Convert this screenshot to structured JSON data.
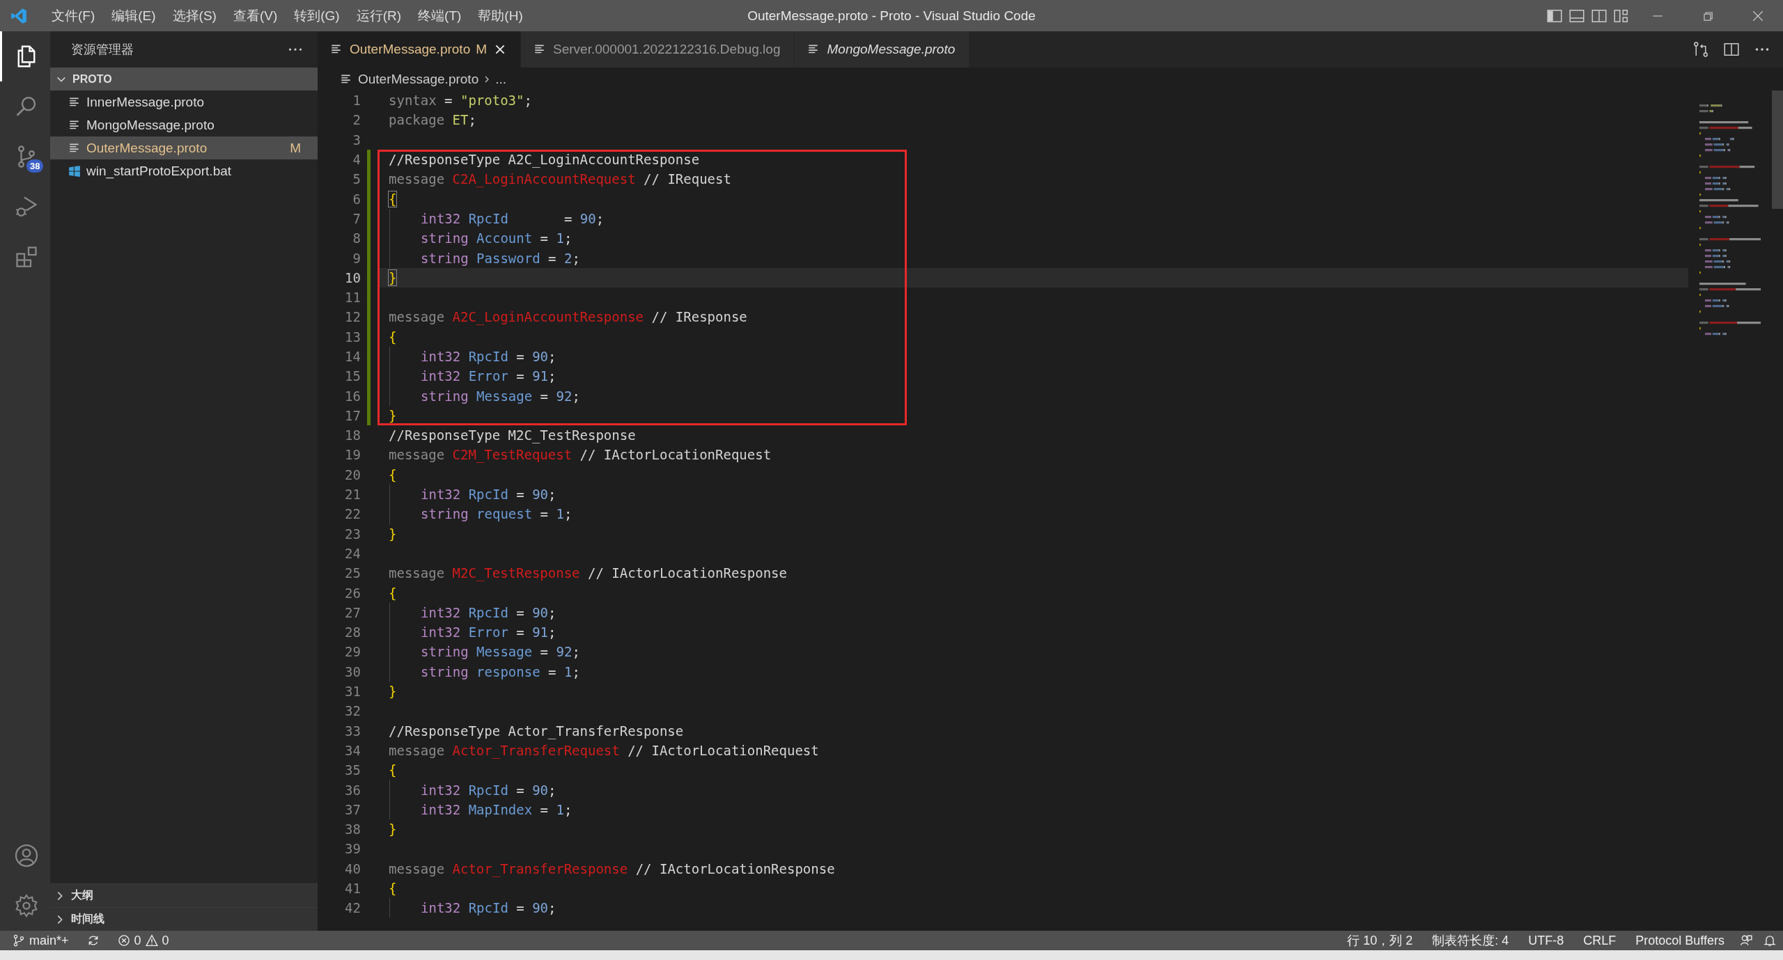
{
  "window": {
    "title": "OuterMessage.proto - Proto - Visual Studio Code"
  },
  "menu": [
    "文件(F)",
    "编辑(E)",
    "选择(S)",
    "查看(V)",
    "转到(G)",
    "运行(R)",
    "终端(T)",
    "帮助(H)"
  ],
  "activity_bar": [
    {
      "kind": "explorer",
      "selected": true
    },
    {
      "kind": "search",
      "selected": false
    },
    {
      "kind": "source-control",
      "selected": false,
      "badge": "38"
    },
    {
      "kind": "run",
      "selected": false
    },
    {
      "kind": "extensions",
      "selected": false
    },
    {
      "kind": "account",
      "selected": false
    },
    {
      "kind": "settings",
      "selected": false
    }
  ],
  "sidebar": {
    "title": "资源管理器",
    "folder": {
      "label": "PROTO",
      "expanded": true
    },
    "files": [
      {
        "name": "InnerMessage.proto",
        "kind": "text",
        "selected": false
      },
      {
        "name": "MongoMessage.proto",
        "kind": "text",
        "selected": false
      },
      {
        "name": "OuterMessage.proto",
        "kind": "text",
        "selected": true,
        "badge": "M"
      },
      {
        "name": "win_startProtoExport.bat",
        "kind": "windows",
        "selected": false
      }
    ],
    "sections": [
      {
        "label": "大纲",
        "expanded": false
      },
      {
        "label": "时间线",
        "expanded": false
      }
    ]
  },
  "tabs": [
    {
      "label": "OuterMessage.proto",
      "selected": true,
      "badge": "M",
      "preview": false
    },
    {
      "label": "Server.000001.2022122316.Debug.log",
      "selected": false,
      "preview": false
    },
    {
      "label": "MongoMessage.proto",
      "selected": false,
      "preview": true
    }
  ],
  "breadcrumb": [
    "OuterMessage.proto",
    "..."
  ],
  "editor": {
    "lines": [
      {
        "number": "1",
        "tokens": [
          {
            "text": "syntax",
            "kind": "keyword"
          },
          {
            "text": " = ",
            "kind": "plain"
          },
          {
            "text": "\"proto3\"",
            "kind": "string"
          },
          {
            "text": ";",
            "kind": "plain"
          }
        ]
      },
      {
        "number": "2",
        "tokens": [
          {
            "text": "package ",
            "kind": "keyword"
          },
          {
            "text": "ET",
            "kind": "string"
          },
          {
            "text": ";",
            "kind": "plain"
          }
        ]
      },
      {
        "number": "3"
      },
      {
        "number": "4",
        "modified": true,
        "boxed": true,
        "tokens": [
          {
            "text": "//ResponseType A2C_LoginAccountResponse",
            "kind": "comment"
          }
        ]
      },
      {
        "number": "5",
        "modified": true,
        "boxed": true,
        "tokens": [
          {
            "text": "message ",
            "kind": "keyword"
          },
          {
            "text": "C2A_LoginAccountRequest",
            "kind": "name"
          },
          {
            "text": " // IRequest",
            "kind": "comment"
          }
        ]
      },
      {
        "number": "6",
        "modified": true,
        "boxed": true,
        "tokens": [
          {
            "text": "{",
            "kind": "bracket-match"
          }
        ]
      },
      {
        "number": "7",
        "modified": true,
        "boxed": true,
        "indented": true,
        "tokens": [
          {
            "text": "int32 ",
            "kind": "type"
          },
          {
            "text": "RpcId",
            "kind": "field"
          },
          {
            "text": "       = ",
            "kind": "plain"
          },
          {
            "text": "90",
            "kind": "number"
          },
          {
            "text": ";",
            "kind": "plain"
          }
        ]
      },
      {
        "number": "8",
        "modified": true,
        "boxed": true,
        "indented": true,
        "tokens": [
          {
            "text": "string ",
            "kind": "type"
          },
          {
            "text": "Account",
            "kind": "field"
          },
          {
            "text": " = ",
            "kind": "plain"
          },
          {
            "text": "1",
            "kind": "number"
          },
          {
            "text": ";",
            "kind": "plain"
          }
        ]
      },
      {
        "number": "9",
        "modified": true,
        "boxed": true,
        "indented": true,
        "tokens": [
          {
            "text": "string ",
            "kind": "type"
          },
          {
            "text": "Password",
            "kind": "field"
          },
          {
            "text": " = ",
            "kind": "plain"
          },
          {
            "text": "2",
            "kind": "number"
          },
          {
            "text": ";",
            "kind": "plain"
          }
        ]
      },
      {
        "number": "10",
        "modified": true,
        "boxed": true,
        "current": true,
        "tokens": [
          {
            "text": "}",
            "kind": "bracket-match"
          }
        ]
      },
      {
        "number": "11",
        "modified": true,
        "boxed": true
      },
      {
        "number": "12",
        "modified": true,
        "boxed": true,
        "tokens": [
          {
            "text": "message ",
            "kind": "keyword"
          },
          {
            "text": "A2C_LoginAccountResponse",
            "kind": "name"
          },
          {
            "text": " // IResponse",
            "kind": "comment"
          }
        ]
      },
      {
        "number": "13",
        "modified": true,
        "boxed": true,
        "tokens": [
          {
            "text": "{",
            "kind": "bracket"
          }
        ]
      },
      {
        "number": "14",
        "modified": true,
        "boxed": true,
        "indented": true,
        "tokens": [
          {
            "text": "int32 ",
            "kind": "type"
          },
          {
            "text": "RpcId",
            "kind": "field"
          },
          {
            "text": " = ",
            "kind": "plain"
          },
          {
            "text": "90",
            "kind": "number"
          },
          {
            "text": ";",
            "kind": "plain"
          }
        ]
      },
      {
        "number": "15",
        "modified": true,
        "boxed": true,
        "indented": true,
        "tokens": [
          {
            "text": "int32 ",
            "kind": "type"
          },
          {
            "text": "Error",
            "kind": "field"
          },
          {
            "text": " = ",
            "kind": "plain"
          },
          {
            "text": "91",
            "kind": "number"
          },
          {
            "text": ";",
            "kind": "plain"
          }
        ]
      },
      {
        "number": "16",
        "modified": true,
        "boxed": true,
        "indented": true,
        "tokens": [
          {
            "text": "string ",
            "kind": "type"
          },
          {
            "text": "Message",
            "kind": "field"
          },
          {
            "text": " = ",
            "kind": "plain"
          },
          {
            "text": "92",
            "kind": "number"
          },
          {
            "text": ";",
            "kind": "plain"
          }
        ]
      },
      {
        "number": "17",
        "modified": true,
        "boxed": true,
        "tokens": [
          {
            "text": "}",
            "kind": "bracket"
          }
        ]
      },
      {
        "number": "18",
        "tokens": [
          {
            "text": "//ResponseType M2C_TestResponse",
            "kind": "comment"
          }
        ]
      },
      {
        "number": "19",
        "tokens": [
          {
            "text": "message ",
            "kind": "keyword"
          },
          {
            "text": "C2M_TestRequest",
            "kind": "name"
          },
          {
            "text": " // IActorLocationRequest",
            "kind": "comment"
          }
        ]
      },
      {
        "number": "20",
        "tokens": [
          {
            "text": "{",
            "kind": "bracket"
          }
        ]
      },
      {
        "number": "21",
        "indented": true,
        "tokens": [
          {
            "text": "int32 ",
            "kind": "type"
          },
          {
            "text": "RpcId",
            "kind": "field"
          },
          {
            "text": " = ",
            "kind": "plain"
          },
          {
            "text": "90",
            "kind": "number"
          },
          {
            "text": ";",
            "kind": "plain"
          }
        ]
      },
      {
        "number": "22",
        "indented": true,
        "tokens": [
          {
            "text": "string ",
            "kind": "type"
          },
          {
            "text": "request",
            "kind": "field"
          },
          {
            "text": " = ",
            "kind": "plain"
          },
          {
            "text": "1",
            "kind": "number"
          },
          {
            "text": ";",
            "kind": "plain"
          }
        ]
      },
      {
        "number": "23",
        "tokens": [
          {
            "text": "}",
            "kind": "bracket"
          }
        ]
      },
      {
        "number": "24"
      },
      {
        "number": "25",
        "tokens": [
          {
            "text": "message ",
            "kind": "keyword"
          },
          {
            "text": "M2C_TestResponse",
            "kind": "name"
          },
          {
            "text": " // IActorLocationResponse",
            "kind": "comment"
          }
        ]
      },
      {
        "number": "26",
        "tokens": [
          {
            "text": "{",
            "kind": "bracket"
          }
        ]
      },
      {
        "number": "27",
        "indented": true,
        "tokens": [
          {
            "text": "int32 ",
            "kind": "type"
          },
          {
            "text": "RpcId",
            "kind": "field"
          },
          {
            "text": " = ",
            "kind": "plain"
          },
          {
            "text": "90",
            "kind": "number"
          },
          {
            "text": ";",
            "kind": "plain"
          }
        ]
      },
      {
        "number": "28",
        "indented": true,
        "tokens": [
          {
            "text": "int32 ",
            "kind": "type"
          },
          {
            "text": "Error",
            "kind": "field"
          },
          {
            "text": " = ",
            "kind": "plain"
          },
          {
            "text": "91",
            "kind": "number"
          },
          {
            "text": ";",
            "kind": "plain"
          }
        ]
      },
      {
        "number": "29",
        "indented": true,
        "tokens": [
          {
            "text": "string ",
            "kind": "type"
          },
          {
            "text": "Message",
            "kind": "field"
          },
          {
            "text": " = ",
            "kind": "plain"
          },
          {
            "text": "92",
            "kind": "number"
          },
          {
            "text": ";",
            "kind": "plain"
          }
        ]
      },
      {
        "number": "30",
        "indented": true,
        "tokens": [
          {
            "text": "string ",
            "kind": "type"
          },
          {
            "text": "response",
            "kind": "field"
          },
          {
            "text": " = ",
            "kind": "plain"
          },
          {
            "text": "1",
            "kind": "number"
          },
          {
            "text": ";",
            "kind": "plain"
          }
        ]
      },
      {
        "number": "31",
        "tokens": [
          {
            "text": "}",
            "kind": "bracket"
          }
        ]
      },
      {
        "number": "32"
      },
      {
        "number": "33",
        "tokens": [
          {
            "text": "//ResponseType Actor_TransferResponse",
            "kind": "comment"
          }
        ]
      },
      {
        "number": "34",
        "tokens": [
          {
            "text": "message ",
            "kind": "keyword"
          },
          {
            "text": "Actor_TransferRequest",
            "kind": "name"
          },
          {
            "text": " // IActorLocationRequest",
            "kind": "comment"
          }
        ]
      },
      {
        "number": "35",
        "tokens": [
          {
            "text": "{",
            "kind": "bracket"
          }
        ]
      },
      {
        "number": "36",
        "indented": true,
        "tokens": [
          {
            "text": "int32 ",
            "kind": "type"
          },
          {
            "text": "RpcId",
            "kind": "field"
          },
          {
            "text": " = ",
            "kind": "plain"
          },
          {
            "text": "90",
            "kind": "number"
          },
          {
            "text": ";",
            "kind": "plain"
          }
        ]
      },
      {
        "number": "37",
        "indented": true,
        "tokens": [
          {
            "text": "int32 ",
            "kind": "type"
          },
          {
            "text": "MapIndex",
            "kind": "field"
          },
          {
            "text": " = ",
            "kind": "plain"
          },
          {
            "text": "1",
            "kind": "number"
          },
          {
            "text": ";",
            "kind": "plain"
          }
        ]
      },
      {
        "number": "38",
        "tokens": [
          {
            "text": "}",
            "kind": "bracket"
          }
        ]
      },
      {
        "number": "39"
      },
      {
        "number": "40",
        "tokens": [
          {
            "text": "message ",
            "kind": "keyword"
          },
          {
            "text": "Actor_TransferResponse",
            "kind": "name"
          },
          {
            "text": " // IActorLocationResponse",
            "kind": "comment"
          }
        ]
      },
      {
        "number": "41",
        "tokens": [
          {
            "text": "{",
            "kind": "bracket"
          }
        ]
      },
      {
        "number": "42",
        "indented": true,
        "tokens": [
          {
            "text": "int32 ",
            "kind": "type"
          },
          {
            "text": "RpcId",
            "kind": "field"
          },
          {
            "text": " = ",
            "kind": "plain"
          },
          {
            "text": "90",
            "kind": "number"
          },
          {
            "text": ";",
            "kind": "plain"
          }
        ]
      }
    ]
  },
  "status_bar": {
    "branch": "main*+",
    "errors": "0",
    "warnings": "0",
    "right": [
      "行 10，列 2",
      "制表符长度: 4",
      "UTF-8",
      "CRLF",
      "Protocol Buffers"
    ]
  }
}
